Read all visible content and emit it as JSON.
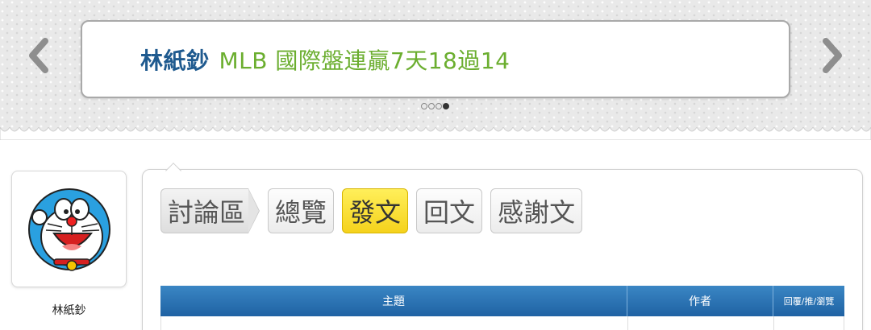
{
  "banner": {
    "author": "林紙鈔",
    "title": "MLB 國際盤連贏7天18過14",
    "slides_count": 4,
    "active_slide": 4,
    "prev_icon": "chevron-left-icon",
    "next_icon": "chevron-right-icon"
  },
  "user": {
    "name": "林紙鈔",
    "avatar": "doraemon-avatar"
  },
  "tabs": {
    "breadcrumb": "討論區",
    "items": [
      {
        "label": "總覽",
        "active": false
      },
      {
        "label": "發文",
        "active": true
      },
      {
        "label": "回文",
        "active": false
      },
      {
        "label": "感謝文",
        "active": false
      }
    ]
  },
  "table": {
    "headers": {
      "subject": "主題",
      "author": "作者",
      "stats": "回覆/推/瀏覽"
    }
  },
  "colors": {
    "author_blue": "#1f5a8f",
    "title_green": "#6bae2f",
    "header_blue": "#2a72b3",
    "active_tab_yellow": "#f9e13a"
  }
}
